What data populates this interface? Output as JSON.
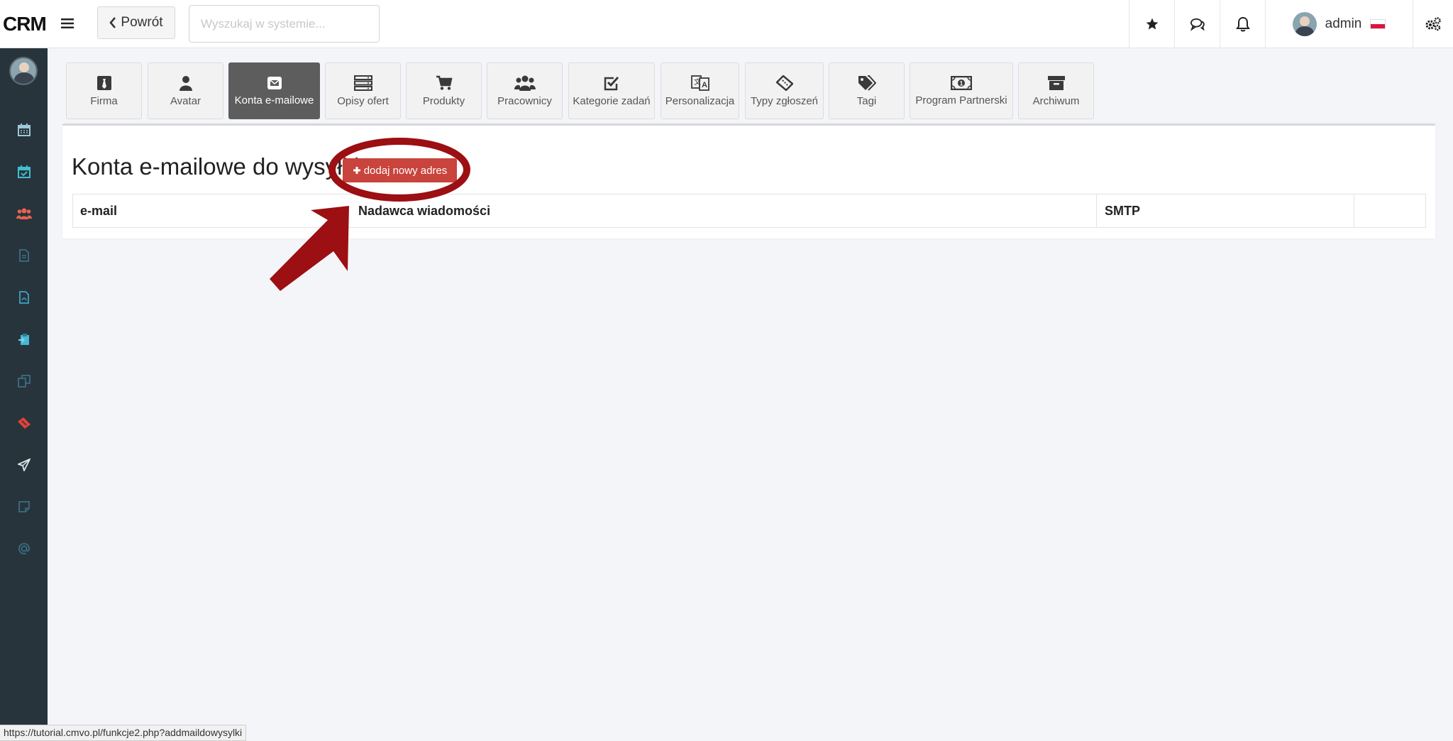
{
  "header": {
    "logo": "CRM",
    "back_label": "Powrót",
    "search_placeholder": "Wyszukaj w systemie...",
    "user_name": "admin"
  },
  "tabs": [
    {
      "label": "Firma",
      "icon": "tie-icon"
    },
    {
      "label": "Avatar",
      "icon": "user-icon"
    },
    {
      "label": "Konta e-mailowe",
      "icon": "envelope-icon",
      "active": true
    },
    {
      "label": "Opisy ofert",
      "icon": "server-icon"
    },
    {
      "label": "Produkty",
      "icon": "cart-icon"
    },
    {
      "label": "Pracownicy",
      "icon": "users-icon"
    },
    {
      "label": "Kategorie zadań",
      "icon": "check-square-icon"
    },
    {
      "label": "Personalizacja",
      "icon": "language-icon"
    },
    {
      "label": "Typy zgłoszeń",
      "icon": "ticket-icon"
    },
    {
      "label": "Tagi",
      "icon": "tags-icon"
    },
    {
      "label": "Program Partnerski",
      "icon": "money-icon"
    },
    {
      "label": "Archiwum",
      "icon": "archive-icon"
    }
  ],
  "main": {
    "title": "Konta e-mailowe do wysyłki",
    "add_button": "dodaj nowy adres",
    "columns": [
      "e-mail",
      "Nadawca wiadomości",
      "SMTP",
      ""
    ]
  },
  "status_url": "https://tutorial.cmvo.pl/funkcje2.php?addmaildowysylki",
  "colors": {
    "sidebar_bg": "#28343b",
    "accent_red": "#c8443c",
    "annotation_red": "#9c0f12",
    "active_tab": "#5d5d5d"
  }
}
